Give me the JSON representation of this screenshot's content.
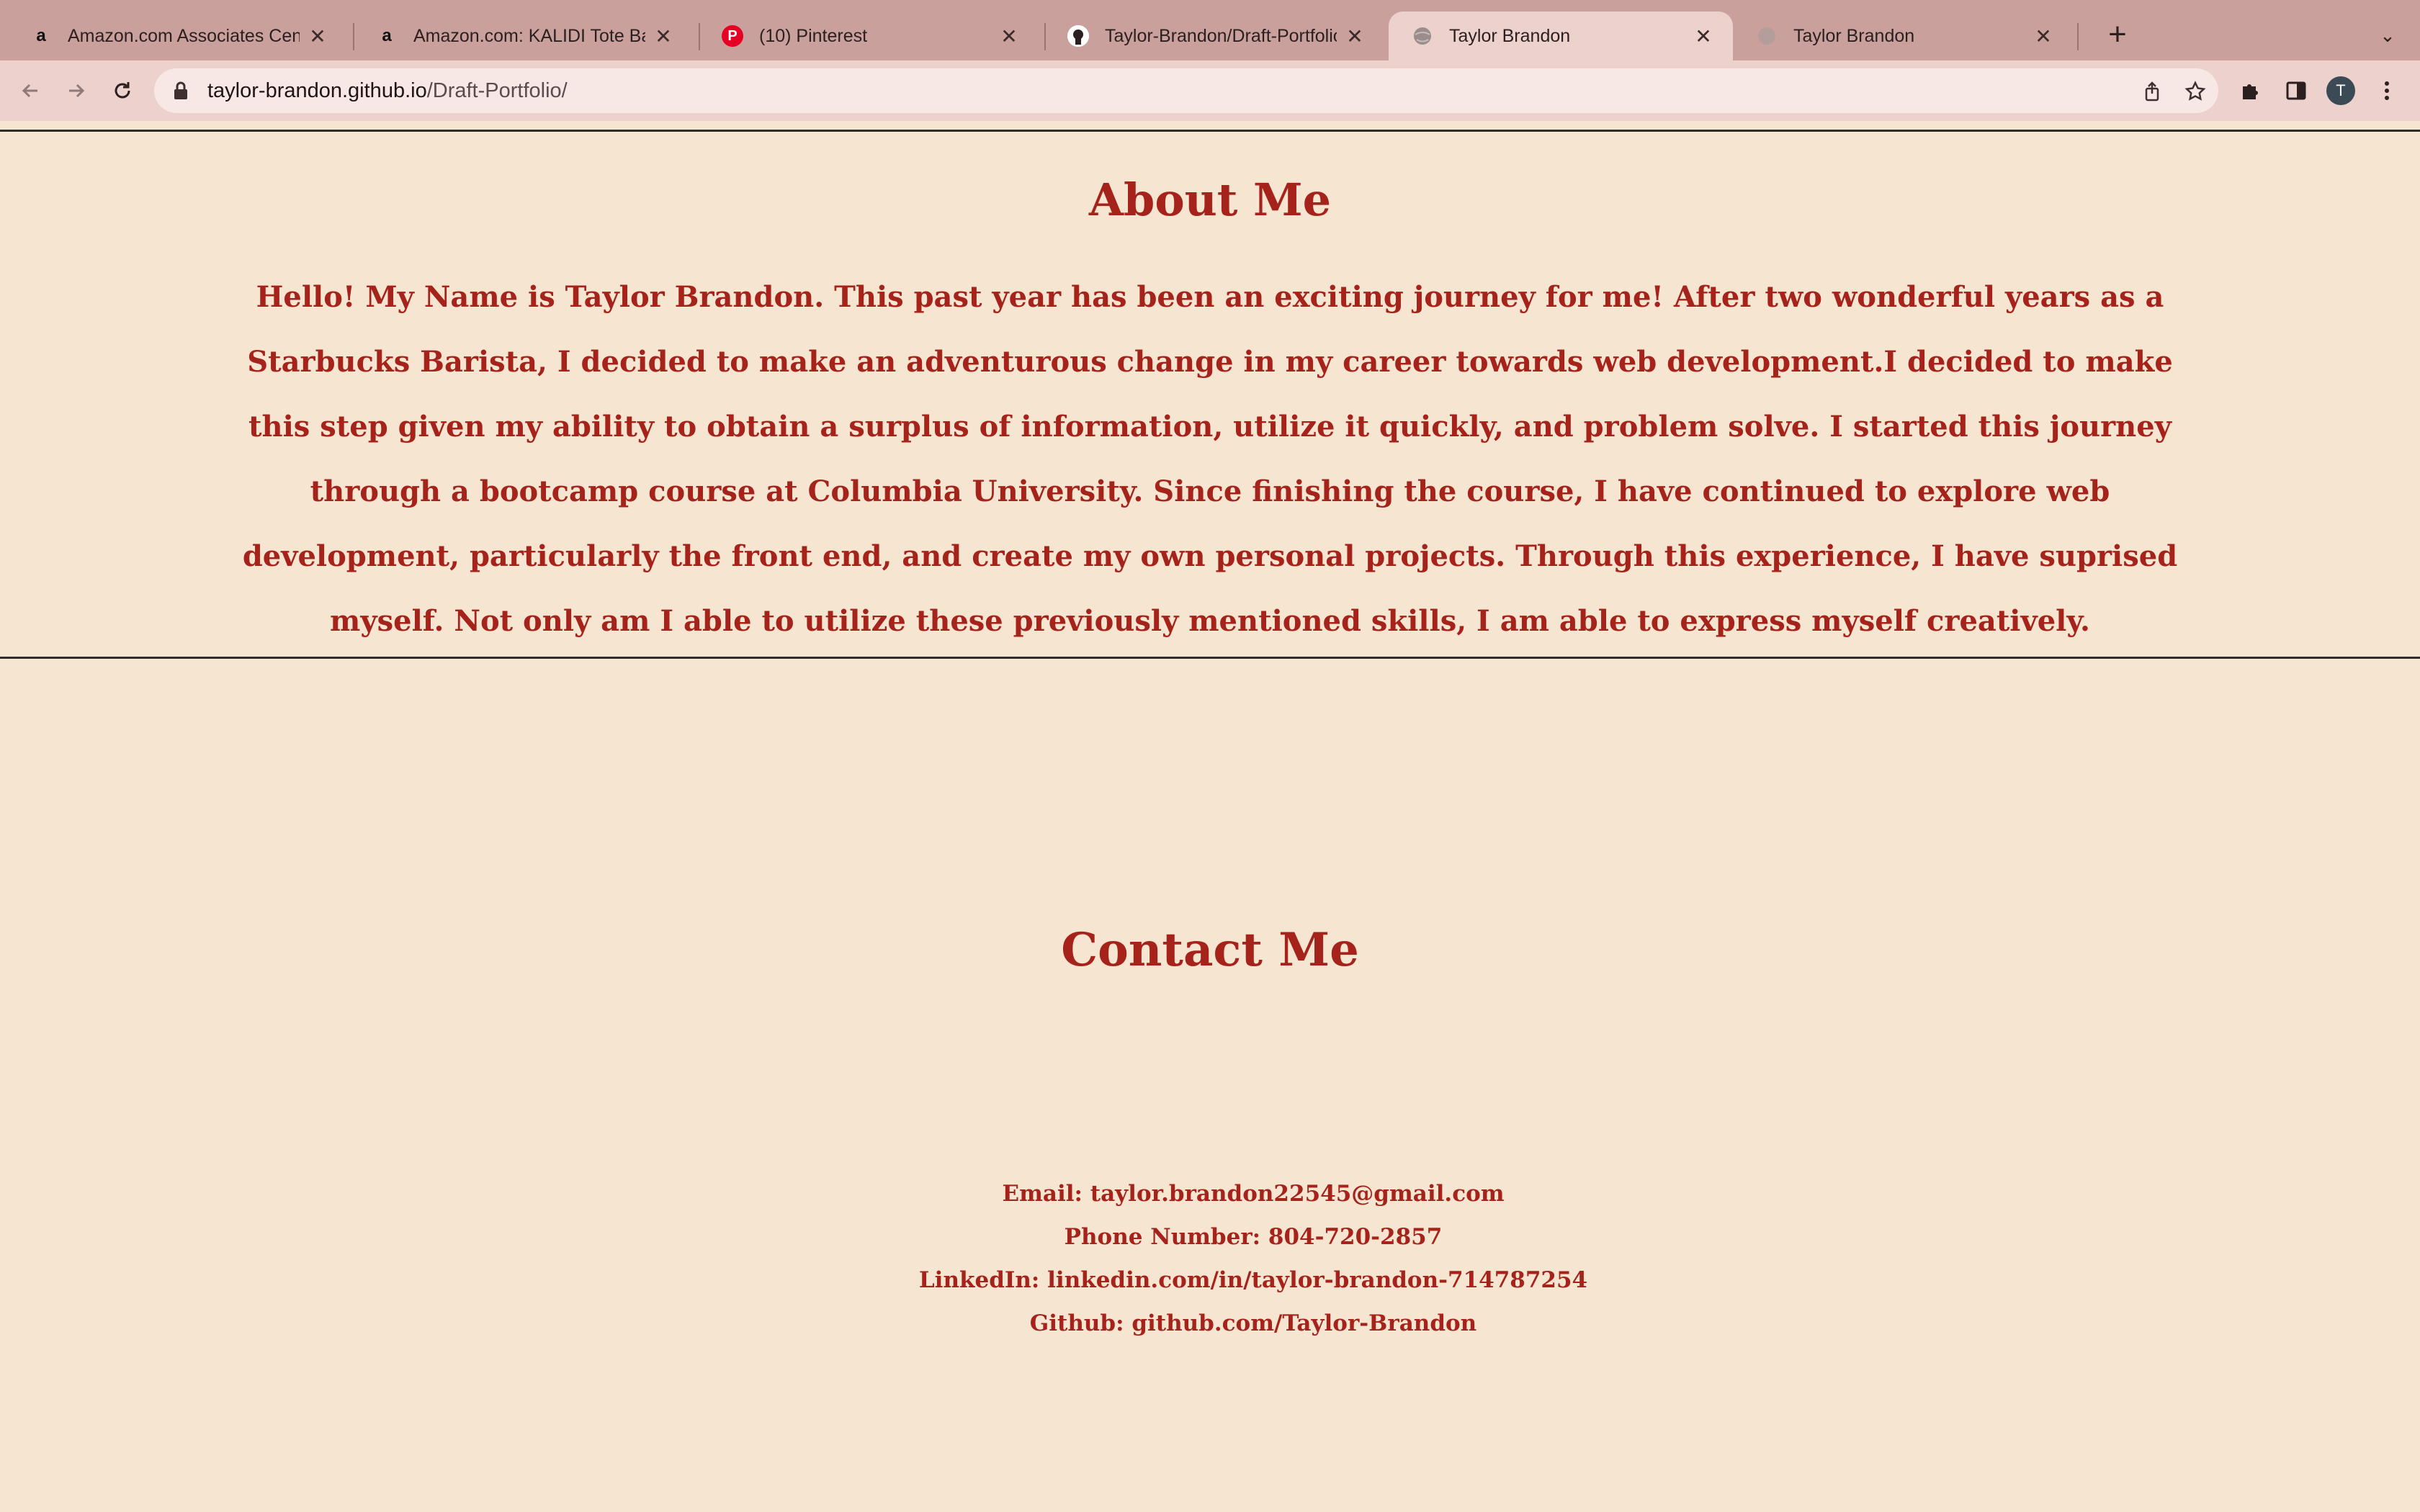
{
  "browser": {
    "tabs": [
      {
        "title": "Amazon.com Associates Cent",
        "favicon": "amazon-icon",
        "active": false
      },
      {
        "title": "Amazon.com: KALIDI Tote Bag",
        "favicon": "amazon-icon",
        "active": false
      },
      {
        "title": "(10) Pinterest",
        "favicon": "pinterest-icon",
        "active": false
      },
      {
        "title": "Taylor-Brandon/Draft-Portfolio",
        "favicon": "github-icon",
        "active": false
      },
      {
        "title": "Taylor Brandon",
        "favicon": "globe-icon",
        "active": true
      },
      {
        "title": "Taylor Brandon",
        "favicon": "globe-icon",
        "active": false
      }
    ],
    "address": {
      "host": "taylor-brandon.github.io",
      "path": "/Draft-Portfolio/"
    },
    "profile_initial": "T",
    "accent_color": "#c9a09b"
  },
  "about": {
    "heading": "About Me",
    "body": "Hello! My Name is Taylor Brandon. This past year has been an exciting journey for me! After two wonderful years as a Starbucks Barista, I decided to make an adventurous change in my career towards web development.I decided to make this step given my ability to obtain a surplus of information, utilize it quickly, and problem solve. I started this journey through a bootcamp course at Columbia University. Since finishing the course, I have continued to explore web development, particularly the front end, and create my own personal projects. Through this experience, I have suprised myself. Not only am I able to utilize these previously mentioned skills, I am able to express myself creatively."
  },
  "contact": {
    "heading": "Contact Me",
    "lines": [
      "Email: taylor.brandon22545@gmail.com",
      "Phone Number: 804-720-2857",
      "LinkedIn: linkedin.com/in/taylor-brandon-714787254",
      "Github: github.com/Taylor-Brandon"
    ]
  },
  "colors": {
    "page_background": "#f6e6d1",
    "heading_text": "#a5231b"
  }
}
